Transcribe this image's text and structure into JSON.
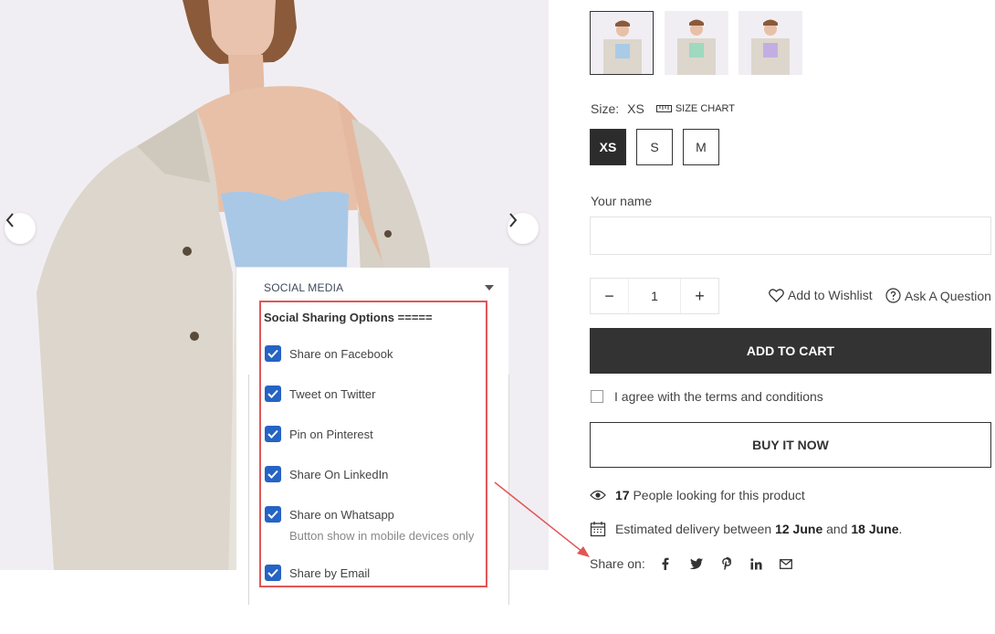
{
  "gallery": {
    "prev_icon": "chevron-left-icon",
    "next_icon": "chevron-right-icon",
    "thumbnail_colors": [
      "#a9cbe6",
      "#9ed9c0",
      "#c3aee3"
    ],
    "active_thumbnail": 0
  },
  "size": {
    "label": "Size:",
    "selected": "XS",
    "chart_label": "SIZE CHART",
    "options": [
      "XS",
      "S",
      "M"
    ]
  },
  "form": {
    "name_label": "Your name",
    "name_value": "",
    "quantity": "1",
    "minus": "−",
    "plus": "+"
  },
  "links": {
    "wishlist": "Add to Wishlist",
    "ask": "Ask A Question"
  },
  "buttons": {
    "add_to_cart": "ADD TO CART",
    "buy_now": "BUY IT NOW"
  },
  "terms": {
    "label": "I agree with the terms and conditions",
    "checked": false
  },
  "info": {
    "viewers_count": "17",
    "viewers_text": "People looking for this product",
    "delivery_prefix": "Estimated delivery between",
    "delivery_start": "12 June",
    "delivery_and": "and",
    "delivery_end": "18 June",
    "delivery_suffix": "."
  },
  "share": {
    "label": "Share on:",
    "icons": [
      "facebook-icon",
      "twitter-icon",
      "pinterest-icon",
      "linkedin-icon",
      "email-icon"
    ]
  },
  "panel": {
    "section_title": "SOCIAL MEDIA",
    "options_title": "Social Sharing Options =====",
    "options": [
      {
        "label": "Share on Facebook",
        "checked": true
      },
      {
        "label": "Tweet on Twitter",
        "checked": true
      },
      {
        "label": "Pin on Pinterest",
        "checked": true
      },
      {
        "label": "Share On LinkedIn",
        "checked": true
      },
      {
        "label": "Share on Whatsapp",
        "checked": true
      },
      {
        "label": "Share by Email",
        "checked": true
      }
    ],
    "whatsapp_note": "Button show in mobile devices only",
    "accent": "#2563c4",
    "highlight": "#e05656"
  },
  "colors": {
    "dark": "#333333",
    "image_bg": "#f1eef3"
  }
}
